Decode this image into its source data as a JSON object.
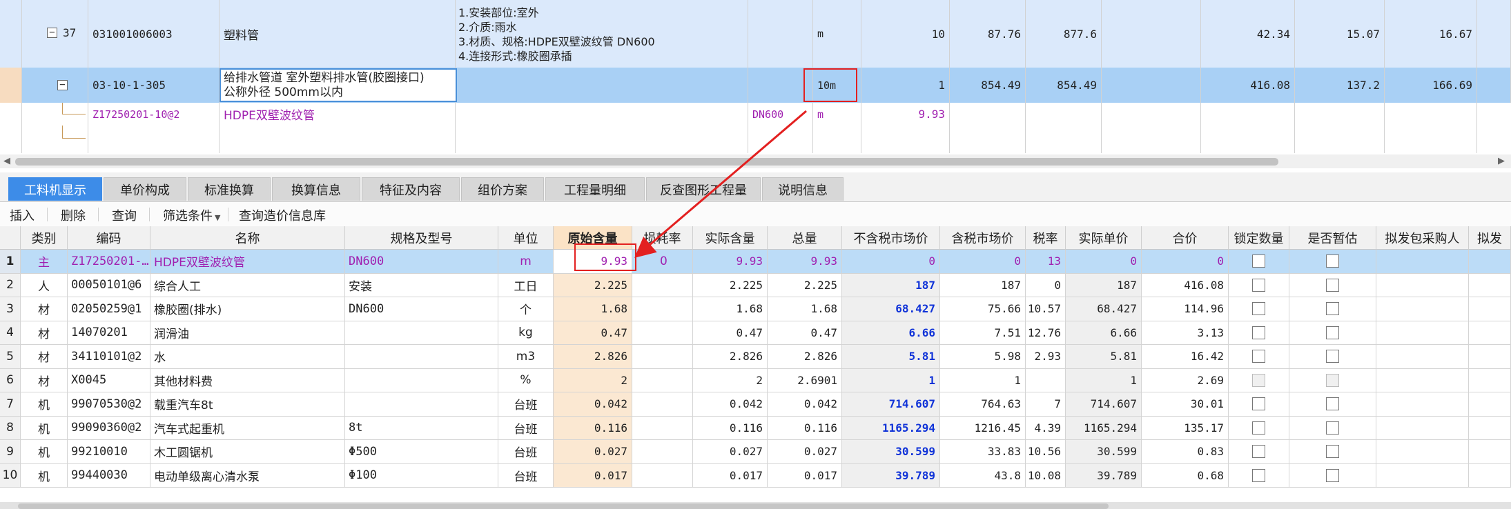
{
  "top_grid": {
    "row37": {
      "index": "37",
      "code": "031001006003",
      "name": "塑料管",
      "desc": [
        "1.安装部位:室外",
        "2.介质:雨水",
        "3.材质、规格:HDPE双壁波纹管 DN600",
        "4.连接形式:橡胶圈承插"
      ],
      "unit": "m",
      "qty": "10",
      "price": "87.76",
      "total": "877.6",
      "c1": "42.34",
      "c2": "15.07",
      "c3": "16.67"
    },
    "row305": {
      "code": "03-10-1-305",
      "name_line1": "给排水管道 室外塑料排水管(胶圈接口)",
      "name_line2": "公称外径 500mm以内",
      "unit": "10m",
      "qty": "1",
      "price": "854.49",
      "total": "854.49",
      "c1": "416.08",
      "c2": "137.2",
      "c3": "166.69"
    },
    "row_material": {
      "code": "Z17250201-10@2",
      "name": "HDPE双壁波纹管",
      "spec": "DN600",
      "unit": "m",
      "qty": "9.93"
    }
  },
  "tabs": [
    "工料机显示",
    "单价构成",
    "标准换算",
    "换算信息",
    "特征及内容",
    "组价方案",
    "工程量明细",
    "反查图形工程量",
    "说明信息"
  ],
  "toolbar": [
    "插入",
    "删除",
    "查询",
    "筛选条件",
    "查询造价信息库"
  ],
  "columns": [
    "类别",
    "编码",
    "名称",
    "规格及型号",
    "单位",
    "原始含量",
    "损耗率",
    "实际含量",
    "总量",
    "不含税市场价",
    "含税市场价",
    "税率",
    "实际单价",
    "合价",
    "锁定数量",
    "是否暂估",
    "拟发包采购人",
    "拟发"
  ],
  "rows": [
    {
      "num": "1",
      "type": "主",
      "code": "Z17250201-…",
      "name": "HDPE双壁波纹管",
      "spec": "DN600",
      "unit": "m",
      "orig": "9.93",
      "loss": "0",
      "actual": "9.93",
      "total": "9.93",
      "price_ex": "0",
      "price_in": "0",
      "tax": "13",
      "unit_price": "0",
      "amount": "0"
    },
    {
      "num": "2",
      "type": "人",
      "code": "00050101@6",
      "name": "综合人工",
      "spec": "安装",
      "unit": "工日",
      "orig": "2.225",
      "loss": "",
      "actual": "2.225",
      "total": "2.225",
      "price_ex": "187",
      "price_in": "187",
      "tax": "0",
      "unit_price": "187",
      "amount": "416.08"
    },
    {
      "num": "3",
      "type": "材",
      "code": "02050259@1",
      "name": "橡胶圈(排水)",
      "spec": "DN600",
      "unit": "个",
      "orig": "1.68",
      "loss": "",
      "actual": "1.68",
      "total": "1.68",
      "price_ex": "68.427",
      "price_in": "75.66",
      "tax": "10.57",
      "unit_price": "68.427",
      "amount": "114.96"
    },
    {
      "num": "4",
      "type": "材",
      "code": "14070201",
      "name": "润滑油",
      "spec": "",
      "unit": "kg",
      "orig": "0.47",
      "loss": "",
      "actual": "0.47",
      "total": "0.47",
      "price_ex": "6.66",
      "price_in": "7.51",
      "tax": "12.76",
      "unit_price": "6.66",
      "amount": "3.13"
    },
    {
      "num": "5",
      "type": "材",
      "code": "34110101@2",
      "name": "水",
      "spec": "",
      "unit": "m3",
      "orig": "2.826",
      "loss": "",
      "actual": "2.826",
      "total": "2.826",
      "price_ex": "5.81",
      "price_in": "5.98",
      "tax": "2.93",
      "unit_price": "5.81",
      "amount": "16.42"
    },
    {
      "num": "6",
      "type": "材",
      "code": "X0045",
      "name": "其他材料费",
      "spec": "",
      "unit": "%",
      "orig": "2",
      "loss": "",
      "actual": "2",
      "total": "2.6901",
      "price_ex": "1",
      "price_in": "1",
      "tax": "",
      "unit_price": "1",
      "amount": "2.69"
    },
    {
      "num": "7",
      "type": "机",
      "code": "99070530@2",
      "name": "载重汽车8t",
      "spec": "",
      "unit": "台班",
      "orig": "0.042",
      "loss": "",
      "actual": "0.042",
      "total": "0.042",
      "price_ex": "714.607",
      "price_in": "764.63",
      "tax": "7",
      "unit_price": "714.607",
      "amount": "30.01"
    },
    {
      "num": "8",
      "type": "机",
      "code": "99090360@2",
      "name": "汽车式起重机",
      "spec": "8t",
      "unit": "台班",
      "orig": "0.116",
      "loss": "",
      "actual": "0.116",
      "total": "0.116",
      "price_ex": "1165.294",
      "price_in": "1216.45",
      "tax": "4.39",
      "unit_price": "1165.294",
      "amount": "135.17"
    },
    {
      "num": "9",
      "type": "机",
      "code": "99210010",
      "name": "木工圆锯机",
      "spec": "Φ500",
      "unit": "台班",
      "orig": "0.027",
      "loss": "",
      "actual": "0.027",
      "total": "0.027",
      "price_ex": "30.599",
      "price_in": "33.83",
      "tax": "10.56",
      "unit_price": "30.599",
      "amount": "0.83"
    },
    {
      "num": "10",
      "type": "机",
      "code": "99440030",
      "name": "电动单级离心清水泵",
      "spec": "Φ100",
      "unit": "台班",
      "orig": "0.017",
      "loss": "",
      "actual": "0.017",
      "total": "0.017",
      "price_ex": "39.789",
      "price_in": "43.8",
      "tax": "10.08",
      "unit_price": "39.789",
      "amount": "0.68"
    }
  ],
  "colors": {
    "tab_active": "#3d8ce8",
    "selected_row": "#a9d0f5",
    "annotation": "#e32020",
    "material_purple": "#a020b0",
    "price_blue": "#1033d8"
  }
}
